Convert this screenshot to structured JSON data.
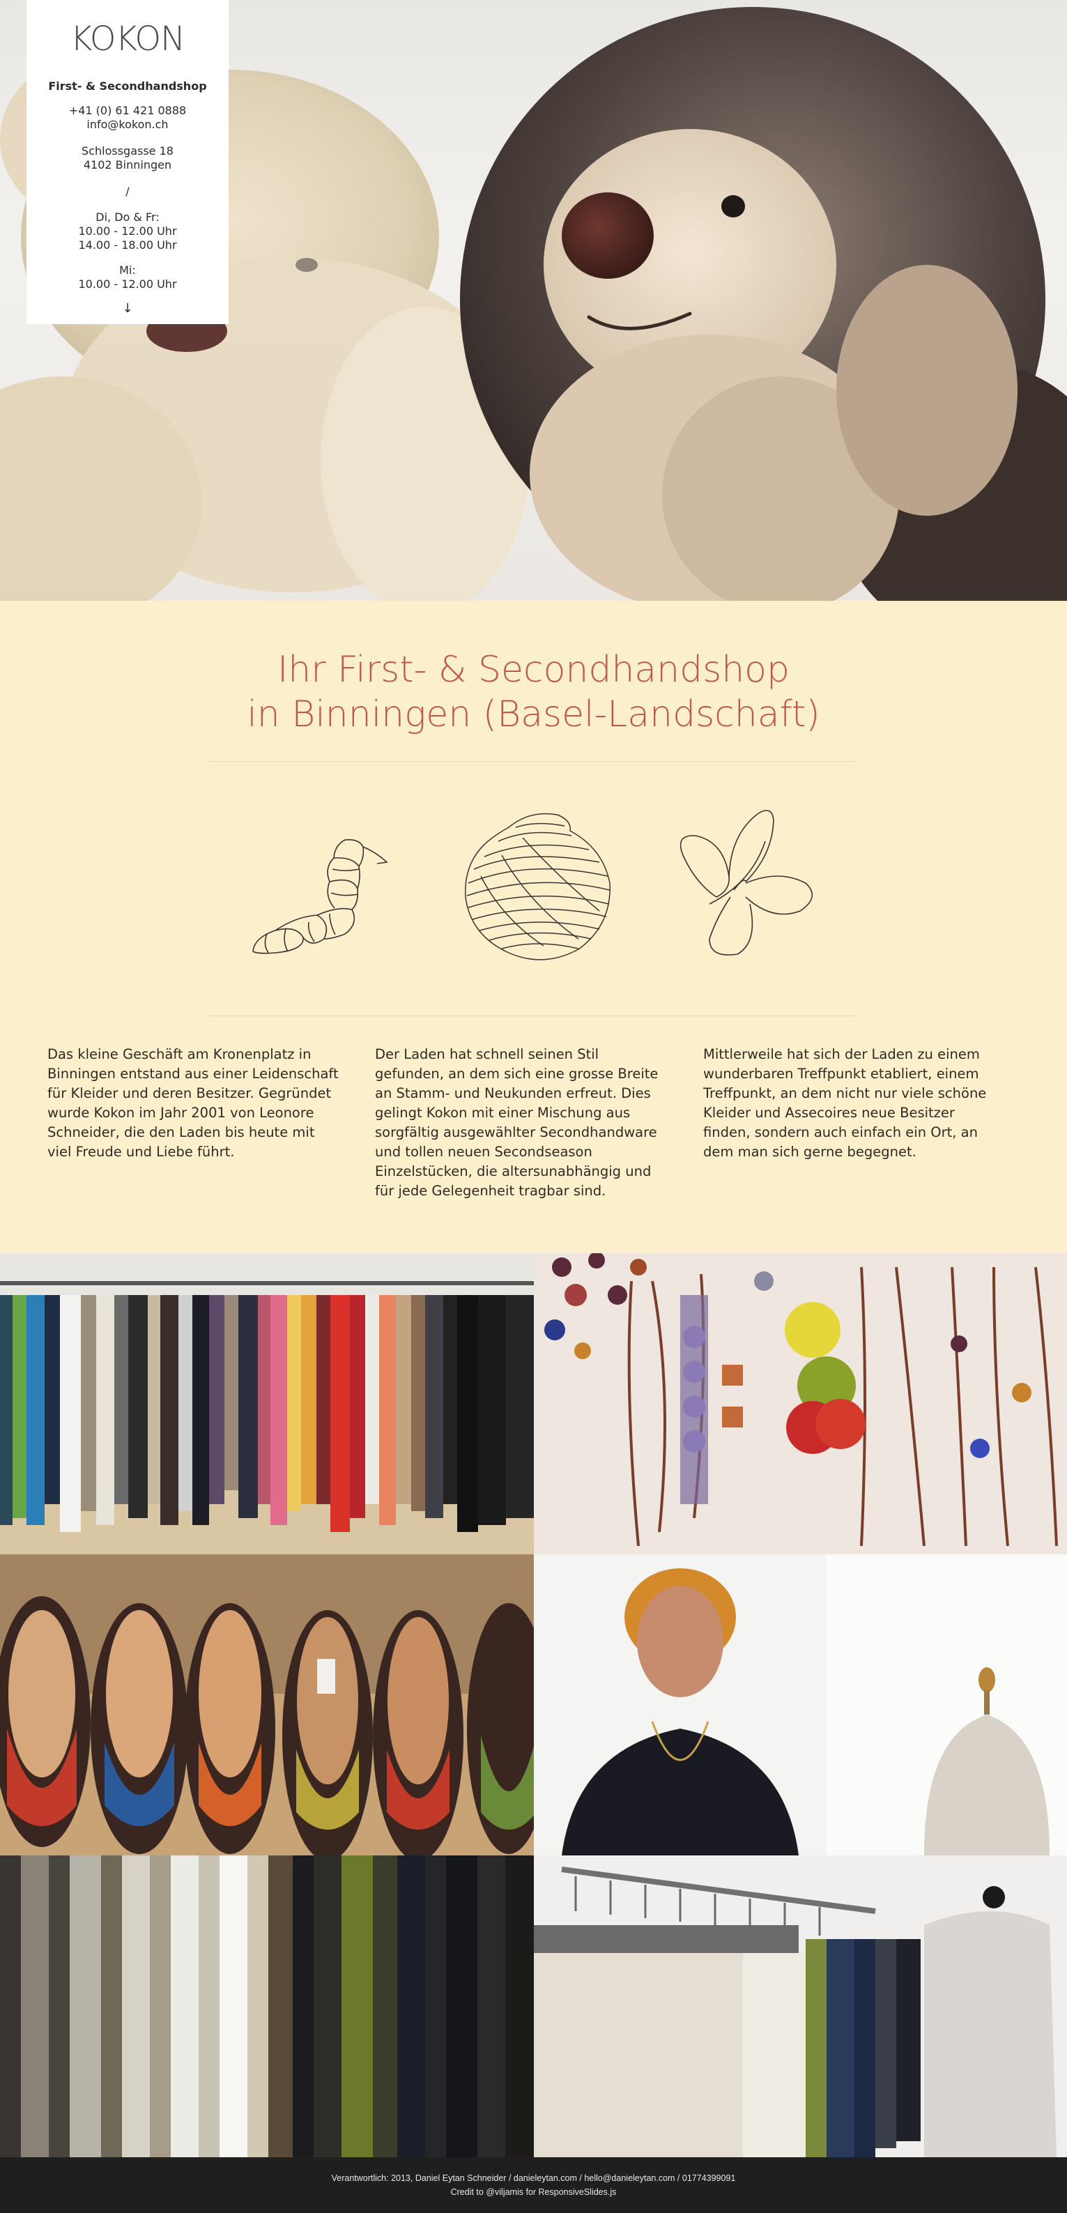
{
  "brand": {
    "logo_text": "KOKON",
    "title": "First- & Secondhandshop",
    "phone": "+41 (0) 61 421 0888",
    "email": "info@kokon.ch",
    "street": "Schlossgasse 18",
    "city": "4102 Binningen",
    "separator": "/",
    "hours_label_1": "Di, Do & Fr:",
    "hours_1a": "10.00 - 12.00 Uhr",
    "hours_1b": "14.00 - 18.00 Uhr",
    "hours_label_2": "Mi:",
    "hours_2a": "10.00 - 12.00 Uhr",
    "scroll_arrow": "↓"
  },
  "hero": {
    "image_icon": "teddy-bear-and-hedgehog-photo"
  },
  "intro": {
    "headline_line1": "Ihr First- & Secondhandshop",
    "headline_line2": "in Binningen (Basel-Landschaft)",
    "illustrations": [
      "caterpillar-icon",
      "cocoon-icon",
      "butterfly-icon"
    ],
    "columns": [
      "Das kleine Geschäft am Kronenplatz in Binningen entstand aus einer Leidenschaft für Kleider und deren Besitzer. Gegründet wurde Kokon im Jahr 2001 von Leonore Schneider, die den Laden bis heute mit viel Freude und Liebe führt.",
      "Der Laden hat schnell seinen Stil gefunden, an dem sich eine grosse Breite an Stamm- und Neukunden erfreut. Dies gelingt Kokon mit einer Mischung aus sorgfältig ausgewählter Secondhandware und tollen neuen Secondseason Einzelstücken, die altersunabhängig und für jede Gelegenheit tragbar sind.",
      "Mittlerweile hat sich der Laden zu einem wunderbaren Treffpunkt etabliert, einem Treffpunkt, an dem nicht nur viele schöne Kleider und Assecoires neue Besitzer finden, sondern auch einfach ein Ort, an dem man sich gerne begegnet."
    ]
  },
  "gallery": {
    "photos": [
      "clothes-rack-photo",
      "necklaces-photo",
      "kilim-shoes-photo",
      "shop-owner-photo",
      "trousers-photo",
      "hangers-rack-photo"
    ]
  },
  "footer": {
    "line1": "Verantwortlich: 2013, Daniel Eytan Schneider / danieleytan.com / hello@danieleytan.com / 01774399091",
    "line2": "Credit to @viljamis for ResponsiveSlides.js"
  },
  "colors": {
    "accent": "#bd5a47",
    "cream": "#fcf0cc",
    "footer_bg": "#1f1f1f"
  }
}
